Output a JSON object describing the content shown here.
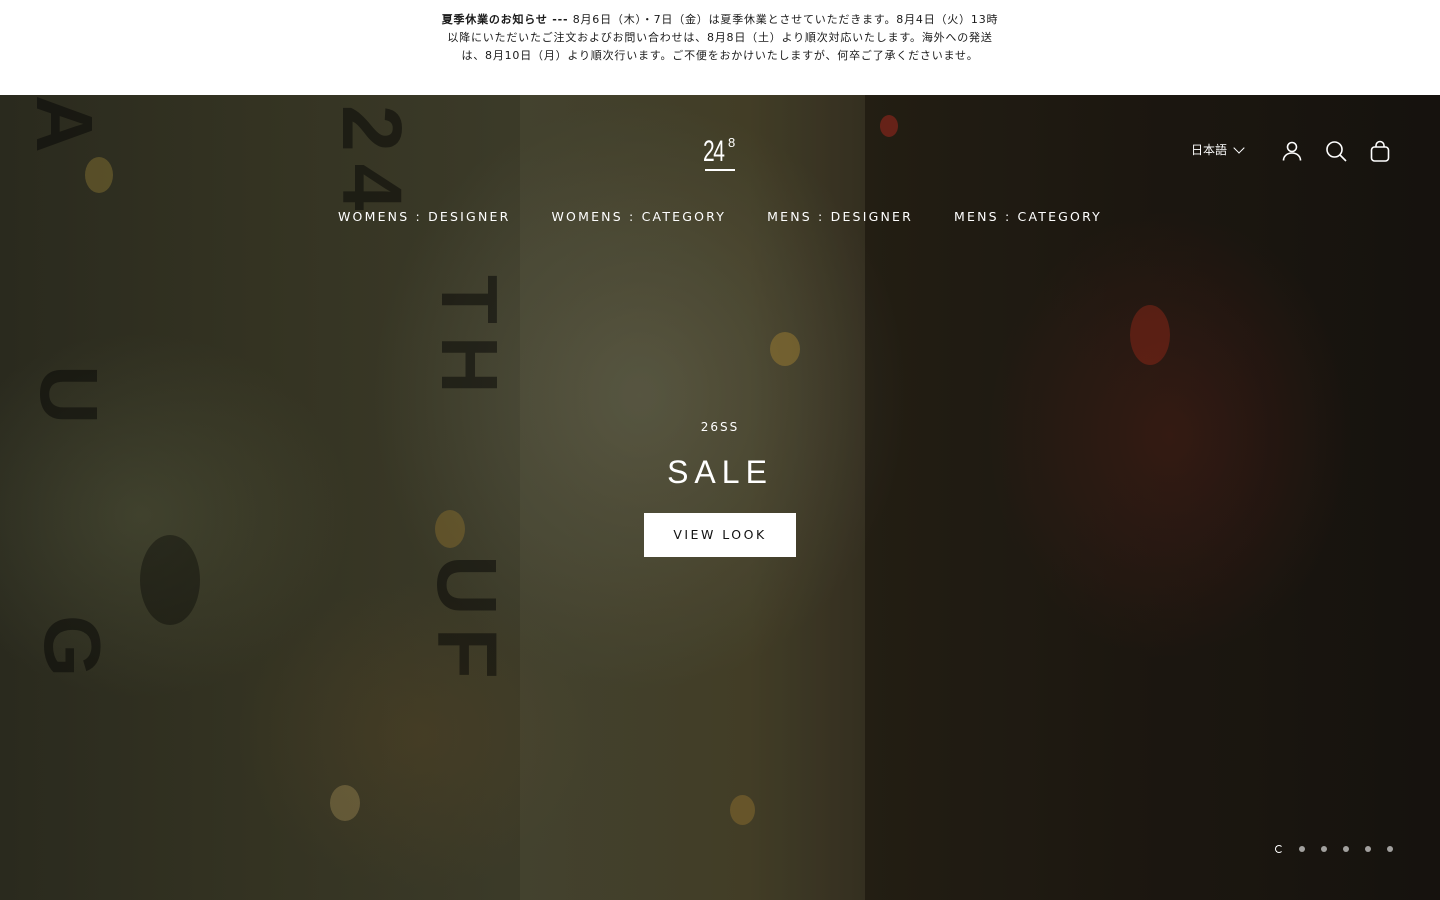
{
  "announcement": {
    "title": "夏季休業のお知らせ ---",
    "body": " 8月6日（木）・7日（金）は夏季休業とさせていただきます。8月4日（火）13時以降にいただいたご注文およびお問い合わせは、8月8日（土）より順次対応いたします。海外への発送は、8月10日（月）より順次行います。ご不便をおかけいたしますが、何卒ご了承くださいませ。"
  },
  "header": {
    "logo_main": "24",
    "logo_sup": "8",
    "language": "日本語",
    "icons": [
      "account-icon",
      "search-icon",
      "cart-icon"
    ]
  },
  "nav": {
    "items": [
      {
        "label": "WOMENS : DESIGNER"
      },
      {
        "label": "WOMENS : CATEGORY"
      },
      {
        "label": "MENS : DESIGNER"
      },
      {
        "label": "MENS : CATEGORY"
      }
    ]
  },
  "hero": {
    "eyebrow": "26SS",
    "headline": "SALE",
    "cta_label": "VIEW LOOK",
    "slide_count": 6,
    "active_slide": 1
  },
  "colors": {
    "text_on_hero": "#ffffff",
    "announcement_bg": "#ffffff",
    "announcement_text": "#1a1a1a"
  }
}
